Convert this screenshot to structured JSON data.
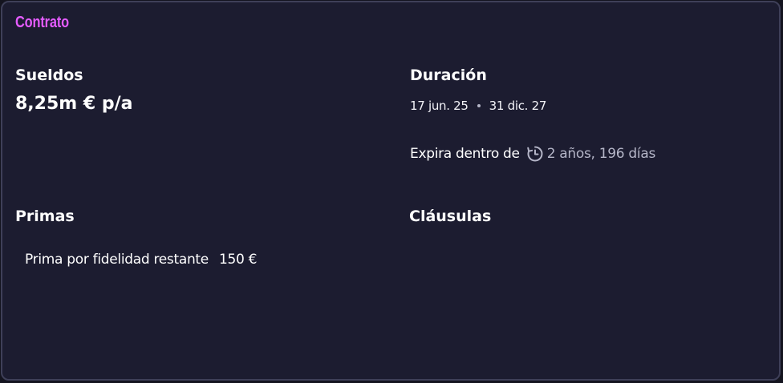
{
  "panel": {
    "title": "Contrato"
  },
  "salary": {
    "label": "Sueldos",
    "value": "8,25m € p/a"
  },
  "duration": {
    "label": "Duración",
    "start": "17 jun. 25",
    "end": "31 dic. 27",
    "expires_label": "Expira dentro de",
    "expires_icon": "clock-icon",
    "expires_value": "2 años, 196 días"
  },
  "bonuses": {
    "label": "Primas",
    "items": [
      {
        "name": "Prima por fidelidad restante",
        "value": "150 €"
      }
    ]
  },
  "clauses": {
    "label": "Cláusulas"
  },
  "colors": {
    "background": "#1c1c30",
    "border": "#3e3f58",
    "title_accent": "#e55cff",
    "muted_text": "#b5b6c8"
  }
}
